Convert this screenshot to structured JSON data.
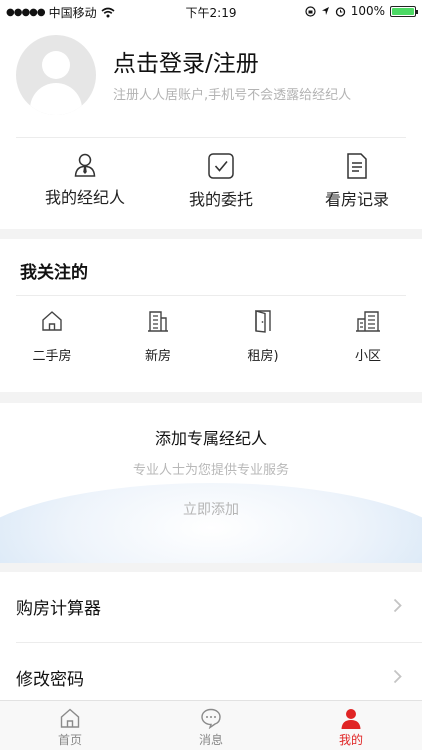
{
  "status_bar": {
    "carrier": "中国移动",
    "time": "下午2:19",
    "battery": "100%",
    "signal_icon": "signal-dots-icon",
    "wifi_icon": "wifi-icon",
    "battery_level": 1.0
  },
  "profile": {
    "title": "点击登录/注册",
    "subtitle": "注册人人居账户,手机号不会透露给经纪人",
    "quick_actions": [
      {
        "label": "我的经纪人",
        "icon": "agent-person-icon"
      },
      {
        "label": "我的委托",
        "icon": "checkbox-check-icon"
      },
      {
        "label": "看房记录",
        "icon": "document-list-icon"
      }
    ]
  },
  "follow": {
    "title": "我关注的",
    "items": [
      {
        "label": "二手房",
        "icon": "house-icon"
      },
      {
        "label": "新房",
        "icon": "building-icon"
      },
      {
        "label": "租房)",
        "icon": "door-icon"
      },
      {
        "label": "小区",
        "icon": "community-icon"
      }
    ]
  },
  "agent_card": {
    "title": "添加专属经纪人",
    "subtitle": "专业人士为您提供专业服务",
    "action": "立即添加"
  },
  "menu": {
    "items": [
      {
        "label": "购房计算器",
        "icon": "chevron-right-icon"
      },
      {
        "label": "修改密码",
        "icon": "chevron-right-icon"
      }
    ]
  },
  "tabbar": {
    "tabs": [
      {
        "label": "首页",
        "icon": "home-icon"
      },
      {
        "label": "消息",
        "icon": "message-icon"
      },
      {
        "label": "我的",
        "icon": "user-icon",
        "active": true
      }
    ]
  },
  "colors": {
    "accent": "#e02424",
    "battery": "#4cd964",
    "muted_text": "#b3b3b3"
  }
}
